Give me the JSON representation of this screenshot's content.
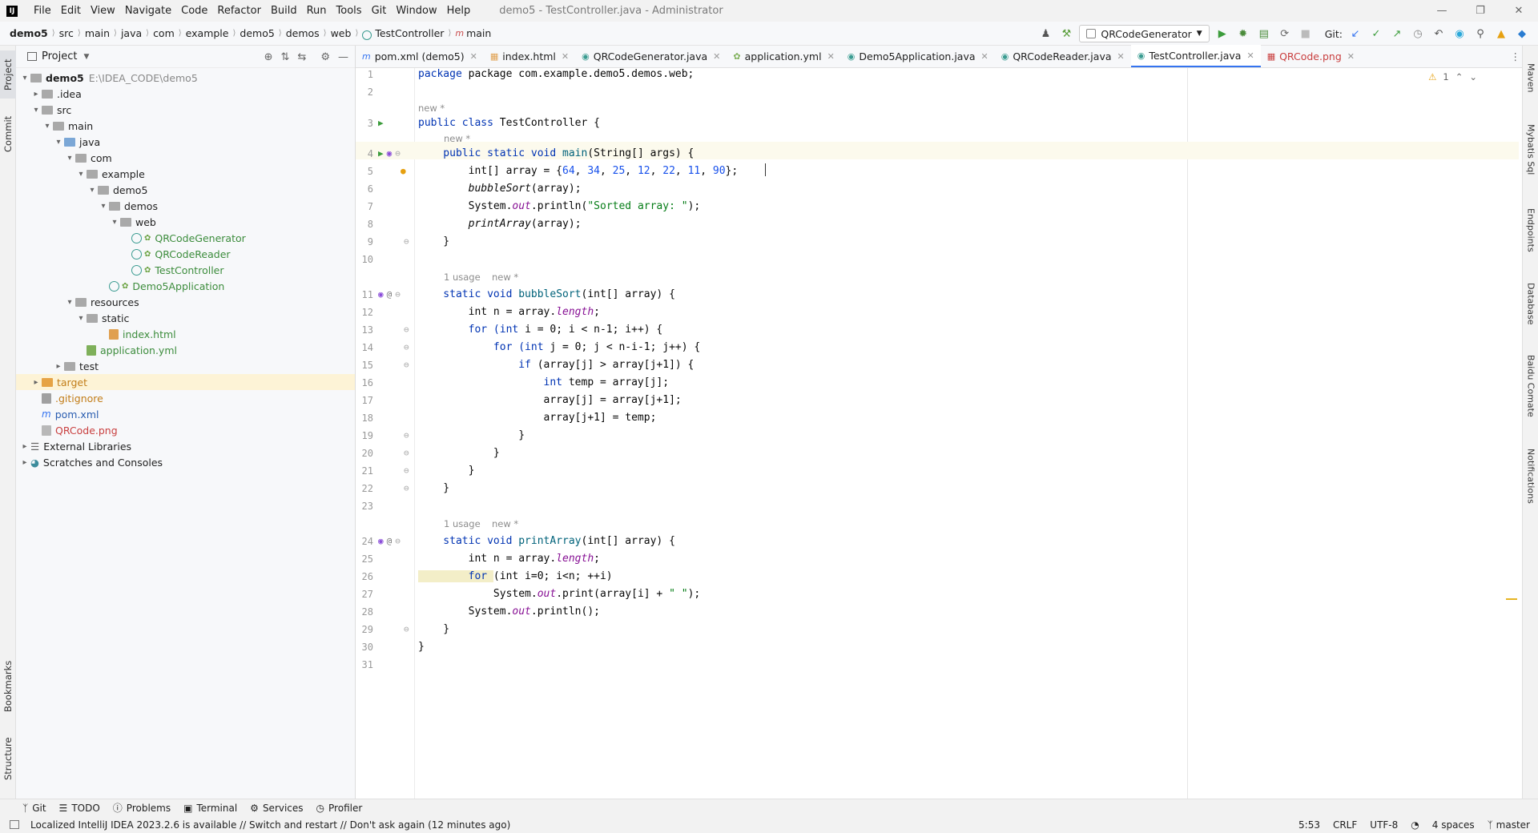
{
  "titlebar": {
    "menu": [
      "File",
      "Edit",
      "View",
      "Navigate",
      "Code",
      "Refactor",
      "Build",
      "Run",
      "Tools",
      "Git",
      "Window",
      "Help"
    ],
    "title": "demo5 - TestController.java - Administrator"
  },
  "navbar": {
    "crumbs": [
      "demo5",
      "src",
      "main",
      "java",
      "com",
      "example",
      "demo5",
      "demos",
      "web",
      "TestController",
      "main"
    ],
    "run_config": "QRCodeGenerator",
    "git_label": "Git:"
  },
  "left_strip": {
    "project": "Project",
    "commit": "Commit",
    "bookmarks": "Bookmarks",
    "structure": "Structure"
  },
  "right_strip": {
    "maven": "Maven",
    "mybatis": "Mybatis Sql",
    "endpoints": "Endpoints",
    "database": "Database",
    "comate": "Baidu Comate",
    "notifications": "Notifications"
  },
  "project": {
    "title": "Project",
    "root_name": "demo5",
    "root_path": "E:\\IDEA_CODE\\demo5",
    "tree": {
      "idea": ".idea",
      "src": "src",
      "main": "main",
      "java": "java",
      "com": "com",
      "example": "example",
      "demo5": "demo5",
      "demos": "demos",
      "web": "web",
      "qrgen": "QRCodeGenerator",
      "qrreader": "QRCodeReader",
      "testctrl": "TestController",
      "app": "Demo5Application",
      "resources": "resources",
      "static": "static",
      "index": "index.html",
      "yml": "application.yml",
      "test": "test",
      "target": "target",
      "gitignore": ".gitignore",
      "pom": "pom.xml",
      "qrpng": "QRCode.png",
      "extlib": "External Libraries",
      "scratches": "Scratches and Consoles"
    }
  },
  "tabs": [
    "pom.xml (demo5)",
    "index.html",
    "QRCodeGenerator.java",
    "application.yml",
    "Demo5Application.java",
    "QRCodeReader.java",
    "TestController.java",
    "QRCode.png"
  ],
  "editor": {
    "warning_count": "1",
    "hints": {
      "new": "new *",
      "usage": "1 usage"
    },
    "lines": {
      "l1": "package com.example.demo5.demos.web;",
      "l3a": "public class ",
      "l3b": "TestController {",
      "l4a": "    public static void ",
      "l4b": "main",
      "l4c": "(String[] args) {",
      "l5a": "        int[] array = {",
      "l5n1": "64",
      "l5n2": "34",
      "l5n3": "25",
      "l5n4": "12",
      "l5n5": "22",
      "l5n6": "11",
      "l5n7": "90",
      "l5z": "};",
      "l6": "bubbleSort",
      "l7a": "        System.",
      "l7b": "out",
      "l7c": ".println(",
      "l7d": "\"Sorted array: \"",
      "l7e": ");",
      "l8": "printArray",
      "l11a": "    static void ",
      "l11b": "bubbleSort",
      "l11c": "(int[] array) {",
      "l12a": "        int n = array.",
      "l12b": "length",
      "l12c": ";",
      "l13a": "        for (int ",
      "l13b": "i = 0; i < n-1; i++) {",
      "l14a": "            for (int ",
      "l14b": "j = 0; j < n-i-1; j++) {",
      "l15a": "                if ",
      "l15b": "(array[j] > array[j+1]) {",
      "l16a": "                    int ",
      "l16b": "temp = array[j];",
      "l17": "                    array[j] = array[j+1];",
      "l18": "                    array[j+1] = temp;",
      "l24a": "    static void ",
      "l24b": "printArray",
      "l24c": "(int[] array) {",
      "l26a": "        for ",
      "l26b": "(int i=0; i<n; ++i)",
      "l27a": "            System.",
      "l27b": "out",
      "l27c": ".print(array[i] + ",
      "l27d": "\" \"",
      "l27e": ");",
      "l28a": "        System.",
      "l28b": "out",
      "l28c": ".println();"
    }
  },
  "bottom_tools": [
    "Git",
    "TODO",
    "Problems",
    "Terminal",
    "Services",
    "Profiler"
  ],
  "status": {
    "message": "Localized IntelliJ IDEA 2023.2.6 is available // Switch and restart // Don't ask again (12 minutes ago)",
    "position": "5:53",
    "line_sep": "CRLF",
    "encoding": "UTF-8",
    "indent": "4 spaces",
    "branch": "master"
  }
}
